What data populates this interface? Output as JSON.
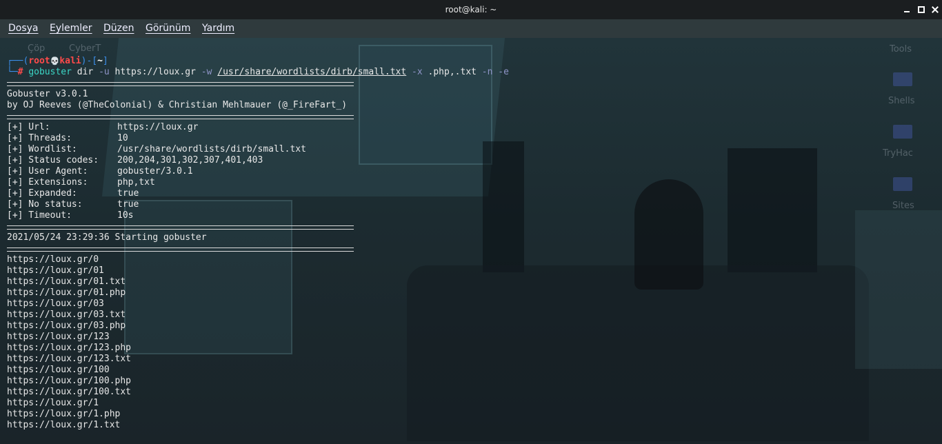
{
  "window": {
    "title": "root@kali: ~"
  },
  "menu": [
    "Dosya",
    "Eylemler",
    "Düzen",
    "Görünüm",
    "Yardım"
  ],
  "desktop_icons": [
    "Çöp",
    "CyberT",
    "Tools",
    "Shells",
    "TryHac",
    "Sites"
  ],
  "prompt": {
    "open_paren": "┌──(",
    "user": "root",
    "skull": "💀",
    "host": "kali",
    "mid": ")-[",
    "dir": "~",
    "close": "]",
    "second_prefix": "└─",
    "hash": "# ",
    "command": "gobuster",
    "subcommand": " dir ",
    "flag_u": "-u",
    "url": " https://loux.gr ",
    "flag_w": "-w",
    "wordlist": "/usr/share/wordlists/dirb/small.txt",
    "flag_x": "-x",
    "ext": " .php,.txt ",
    "flag_n": "-n",
    "flag_e": "-e"
  },
  "banner": {
    "version": "Gobuster v3.0.1",
    "author": "by OJ Reeves (@TheColonial) & Christian Mehlmauer (@_FireFart_)"
  },
  "config": [
    {
      "label": "[+] Url:",
      "value": "https://loux.gr"
    },
    {
      "label": "[+] Threads:",
      "value": "10"
    },
    {
      "label": "[+] Wordlist:",
      "value": "/usr/share/wordlists/dirb/small.txt"
    },
    {
      "label": "[+] Status codes:",
      "value": "200,204,301,302,307,401,403"
    },
    {
      "label": "[+] User Agent:",
      "value": "gobuster/3.0.1"
    },
    {
      "label": "[+] Extensions:",
      "value": "php,txt"
    },
    {
      "label": "[+] Expanded:",
      "value": "true"
    },
    {
      "label": "[+] No status:",
      "value": "true"
    },
    {
      "label": "[+] Timeout:",
      "value": "10s"
    }
  ],
  "start_message": "2021/05/24 23:29:36 Starting gobuster",
  "results": [
    "https://loux.gr/0",
    "https://loux.gr/01",
    "https://loux.gr/01.txt",
    "https://loux.gr/01.php",
    "https://loux.gr/03",
    "https://loux.gr/03.txt",
    "https://loux.gr/03.php",
    "https://loux.gr/123",
    "https://loux.gr/123.php",
    "https://loux.gr/123.txt",
    "https://loux.gr/100",
    "https://loux.gr/100.php",
    "https://loux.gr/100.txt",
    "https://loux.gr/1",
    "https://loux.gr/1.php",
    "https://loux.gr/1.txt"
  ]
}
